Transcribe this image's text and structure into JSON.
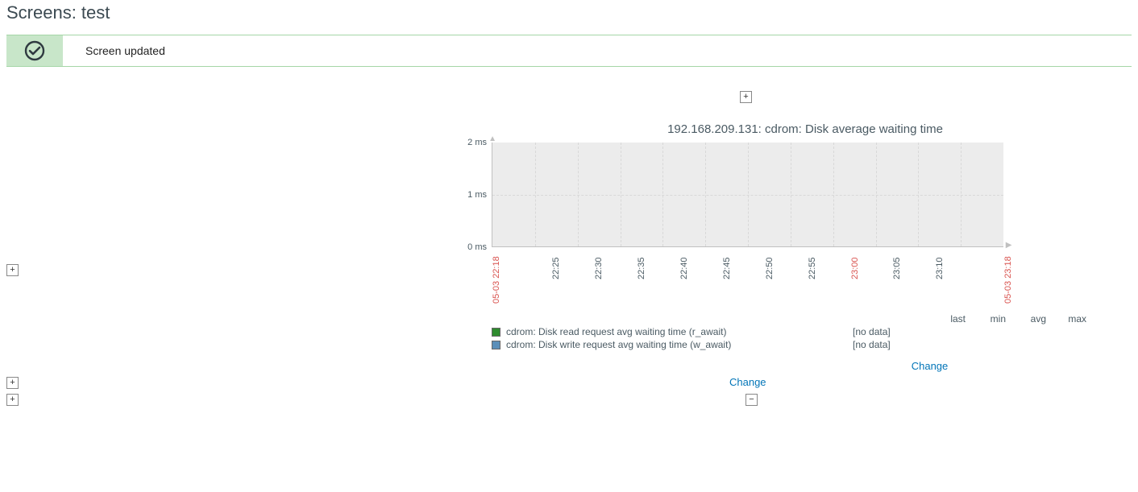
{
  "page": {
    "title": "Screens: test"
  },
  "notice": {
    "text": "Screen updated"
  },
  "chart": {
    "title": "192.168.209.131: cdrom: Disk average waiting time",
    "change_label": "Change"
  },
  "chart_data": {
    "type": "line",
    "title": "192.168.209.131: cdrom: Disk average waiting time",
    "ylabel": "ms",
    "yticks": [
      "0 ms",
      "1 ms",
      "2 ms"
    ],
    "ylim": [
      0,
      2
    ],
    "x_start": "05-03 22:18",
    "x_end": "05-03 23:18",
    "xticks": [
      "22:25",
      "22:30",
      "22:35",
      "22:40",
      "22:45",
      "22:50",
      "22:55",
      "23:00",
      "23:05",
      "23:10"
    ],
    "series": [
      {
        "name": "cdrom: Disk read request avg waiting time (r_await)",
        "color": "#2e8b2e",
        "status": "[no data]",
        "values": []
      },
      {
        "name": "cdrom: Disk write request avg waiting time (w_await)",
        "color": "#5b8fb9",
        "status": "[no data]",
        "values": []
      }
    ],
    "stat_headers": [
      "last",
      "min",
      "avg",
      "max"
    ]
  }
}
